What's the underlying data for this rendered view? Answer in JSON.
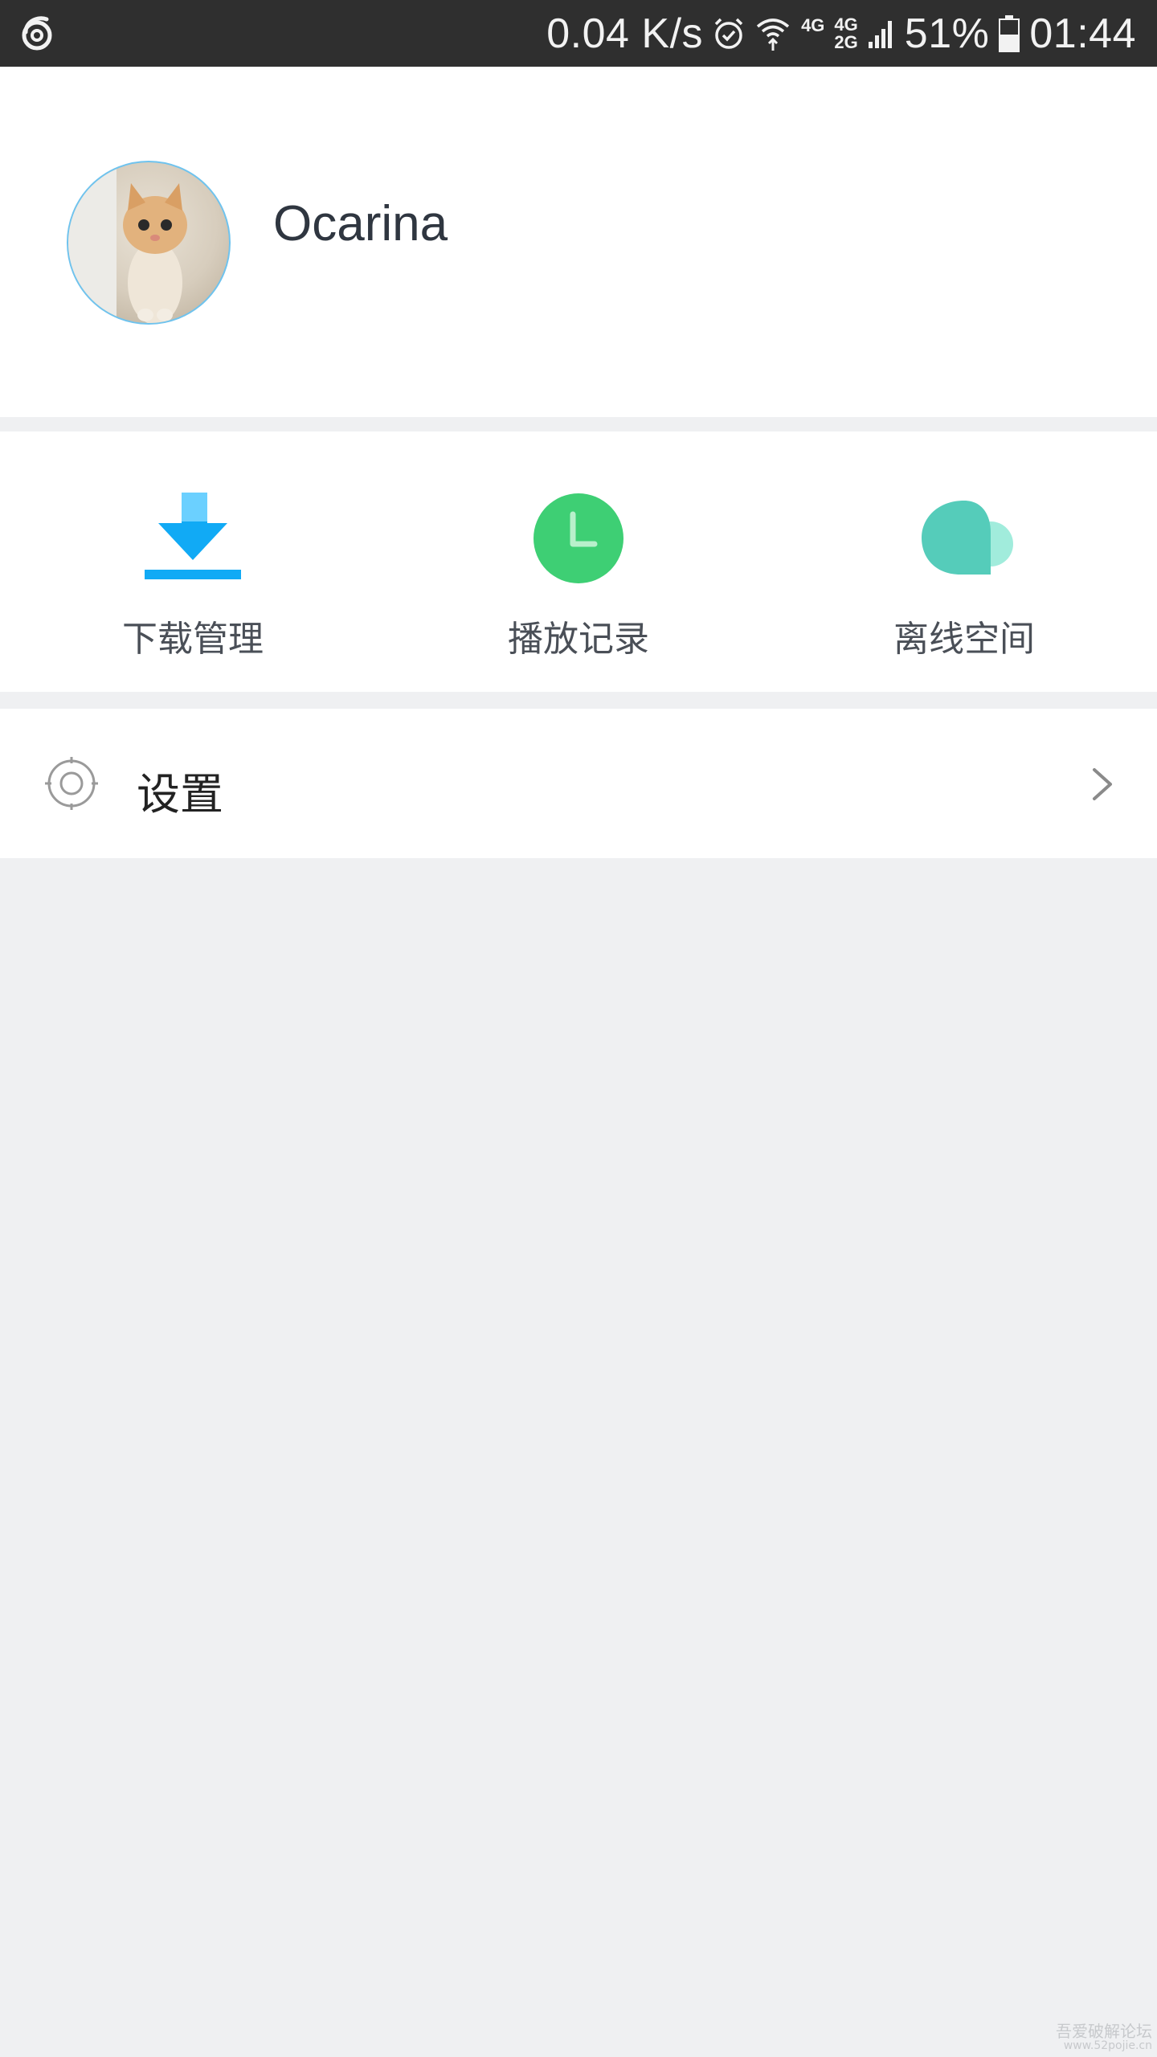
{
  "status_bar": {
    "speed": "0.04 K/s",
    "net_top": "4G",
    "net_dual_top": "4G",
    "net_dual_bottom": "2G",
    "battery": "51%",
    "time": "01:44",
    "icons": [
      "app-swirl-icon",
      "alarm-icon",
      "wifi-icon",
      "signal-icon",
      "battery-icon"
    ]
  },
  "profile": {
    "username": "Ocarina",
    "avatar": "kitten-photo"
  },
  "quick_actions": [
    {
      "label": "下载管理",
      "icon": "download-icon",
      "color": "#29b6f6"
    },
    {
      "label": "播放记录",
      "icon": "clock-icon",
      "color": "#3ecf74"
    },
    {
      "label": "离线空间",
      "icon": "cloud-icon",
      "color": "#55ccba"
    }
  ],
  "settings": {
    "label": "设置",
    "icon": "gear-icon"
  },
  "watermark": {
    "line1": "吾爱破解论坛",
    "line2": "www.52pojie.cn"
  }
}
